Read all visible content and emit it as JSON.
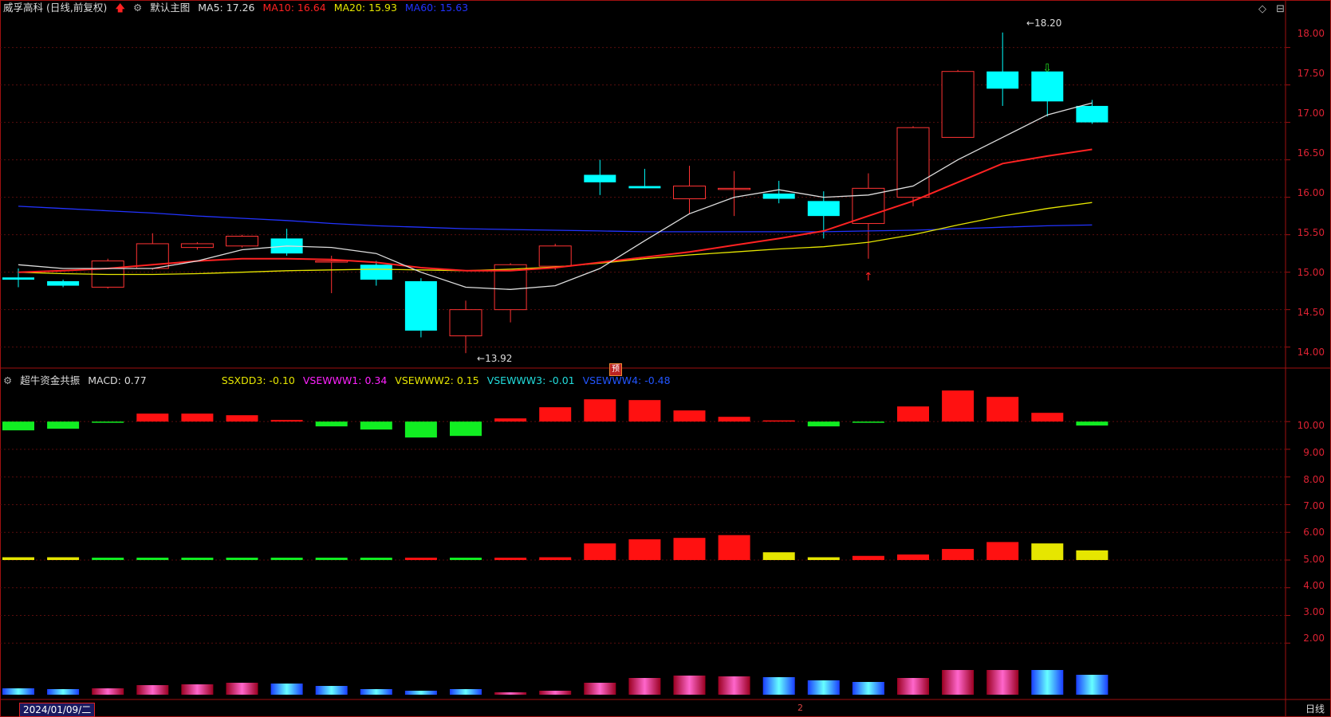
{
  "header": {
    "stock_name": "威孚高科 (日线,前复权)",
    "main_chart_label": "默认主图",
    "ma": [
      {
        "label": "MA5: 17.26",
        "color": "#dddddd"
      },
      {
        "label": "MA10: 16.64",
        "color": "#ff2222"
      },
      {
        "label": "MA20: 15.93",
        "color": "#e6e600"
      },
      {
        "label": "MA60: 15.63",
        "color": "#2233ff"
      }
    ]
  },
  "indicator_header": {
    "name": "超牛资金共振",
    "macd": "MACD: 0.77",
    "items": [
      {
        "label": "SSXDD3: -0.10",
        "color": "#e6e600"
      },
      {
        "label": "VSEWWW1: 0.34",
        "color": "#ff22ff"
      },
      {
        "label": "VSEWWW2: 0.15",
        "color": "#e6e600"
      },
      {
        "label": "VSEWWW3: -0.01",
        "color": "#22dddd"
      },
      {
        "label": "VSEWWW4: -0.48",
        "color": "#2255ff"
      }
    ]
  },
  "price_axis": [
    "18.00",
    "17.50",
    "17.00",
    "16.50",
    "16.00",
    "15.50",
    "15.00",
    "14.50",
    "14.00"
  ],
  "indicator_axis": [
    "10.00",
    "9.00",
    "8.00",
    "7.00",
    "6.00",
    "5.00",
    "4.00",
    "3.00",
    "2.00"
  ],
  "annotations": {
    "high": "18.20",
    "low": "13.92",
    "yu": "预"
  },
  "footer": {
    "date": "2024/01/09/二",
    "period": "日线",
    "marker": "2"
  },
  "chart_data": {
    "type": "candlestick",
    "candles": [
      {
        "o": 14.93,
        "c": 14.9,
        "h": 15.05,
        "l": 14.8
      },
      {
        "o": 14.88,
        "c": 14.82,
        "h": 14.9,
        "l": 14.8
      },
      {
        "o": 14.8,
        "c": 15.15,
        "h": 15.18,
        "l": 14.78
      },
      {
        "o": 15.05,
        "c": 15.38,
        "h": 15.52,
        "l": 15.03
      },
      {
        "o": 15.33,
        "c": 15.38,
        "h": 15.4,
        "l": 15.3
      },
      {
        "o": 15.35,
        "c": 15.48,
        "h": 15.5,
        "l": 15.33
      },
      {
        "o": 15.45,
        "c": 15.25,
        "h": 15.58,
        "l": 15.22
      },
      {
        "o": 15.15,
        "c": 15.15,
        "h": 15.22,
        "l": 14.72
      },
      {
        "o": 15.1,
        "c": 14.9,
        "h": 15.15,
        "l": 14.82
      },
      {
        "o": 14.88,
        "c": 14.22,
        "h": 14.92,
        "l": 14.13
      },
      {
        "o": 14.15,
        "c": 14.5,
        "h": 14.62,
        "l": 13.92
      },
      {
        "o": 14.5,
        "c": 15.1,
        "h": 15.12,
        "l": 14.33
      },
      {
        "o": 15.08,
        "c": 15.35,
        "h": 15.38,
        "l": 15.03
      },
      {
        "o": 16.3,
        "c": 16.2,
        "h": 16.5,
        "l": 16.03
      },
      {
        "o": 16.15,
        "c": 16.12,
        "h": 16.38,
        "l": 16.12
      },
      {
        "o": 15.98,
        "c": 16.15,
        "h": 16.42,
        "l": 15.78
      },
      {
        "o": 16.12,
        "c": 16.12,
        "h": 16.35,
        "l": 15.75
      },
      {
        "o": 16.05,
        "c": 15.98,
        "h": 16.22,
        "l": 15.92
      },
      {
        "o": 15.95,
        "c": 15.75,
        "h": 16.08,
        "l": 15.45
      },
      {
        "o": 15.65,
        "c": 16.12,
        "h": 16.32,
        "l": 15.18
      },
      {
        "o": 16.0,
        "c": 16.93,
        "h": 16.95,
        "l": 15.88
      },
      {
        "o": 16.8,
        "c": 17.68,
        "h": 17.7,
        "l": 16.8
      },
      {
        "o": 17.68,
        "c": 17.45,
        "h": 18.2,
        "l": 17.22
      },
      {
        "o": 17.68,
        "c": 17.28,
        "h": 17.68,
        "l": 17.08
      },
      {
        "o": 17.22,
        "c": 17.0,
        "h": 17.3,
        "l": 16.98
      }
    ],
    "ma5": [
      15.1,
      15.05,
      15.05,
      15.05,
      15.15,
      15.3,
      15.35,
      15.33,
      15.25,
      15.0,
      14.8,
      14.77,
      14.82,
      15.05,
      15.42,
      15.78,
      16.0,
      16.1,
      16.0,
      16.03,
      16.15,
      16.5,
      16.8,
      17.1,
      17.26
    ],
    "ma10": [
      15.0,
      15.02,
      15.05,
      15.1,
      15.15,
      15.18,
      15.18,
      15.17,
      15.13,
      15.06,
      15.02,
      15.02,
      15.06,
      15.13,
      15.2,
      15.27,
      15.36,
      15.45,
      15.55,
      15.75,
      15.95,
      16.2,
      16.45,
      16.55,
      16.64
    ],
    "ma20": [
      15.0,
      14.98,
      14.97,
      14.97,
      14.98,
      15.0,
      15.02,
      15.03,
      15.04,
      15.03,
      15.02,
      15.04,
      15.07,
      15.12,
      15.18,
      15.23,
      15.27,
      15.31,
      15.34,
      15.4,
      15.5,
      15.63,
      15.75,
      15.85,
      15.93
    ],
    "ma60": [
      15.88,
      15.85,
      15.82,
      15.79,
      15.75,
      15.72,
      15.69,
      15.65,
      15.62,
      15.6,
      15.58,
      15.57,
      15.56,
      15.55,
      15.54,
      15.54,
      15.54,
      15.54,
      15.54,
      15.55,
      15.56,
      15.58,
      15.6,
      15.62,
      15.63
    ],
    "macd_bars": [
      -0.55,
      -0.45,
      -0.05,
      0.5,
      0.5,
      0.4,
      0.1,
      -0.3,
      -0.5,
      -1.0,
      -0.9,
      0.2,
      0.9,
      1.4,
      1.35,
      0.7,
      0.3,
      0.05,
      -0.3,
      -0.05,
      0.95,
      1.95,
      1.55,
      0.55,
      -0.25
    ],
    "macd_colors": [
      "#11ee22",
      "#11ee22",
      "#11ee22",
      "#ff1111",
      "#ff1111",
      "#ff1111",
      "#ff1111",
      "#11ee22",
      "#11ee22",
      "#11ee22",
      "#11ee22",
      "#ff1111",
      "#ff1111",
      "#ff1111",
      "#ff1111",
      "#ff1111",
      "#ff1111",
      "#ff1111",
      "#11ee22",
      "#11ee22",
      "#ff1111",
      "#ff1111",
      "#ff1111",
      "#ff1111",
      "#11ee22"
    ],
    "sig_bars": [
      5.1,
      5.1,
      5.0,
      5.0,
      5.0,
      5.0,
      5.0,
      5.0,
      5.0,
      4.98,
      5.0,
      4.98,
      5.1,
      5.6,
      5.75,
      5.8,
      5.9,
      5.28,
      5.1,
      5.15,
      5.2,
      5.4,
      5.65,
      5.6,
      5.35
    ],
    "sig_colors": [
      "#e6e600",
      "#e6e600",
      "#11ee22",
      "#11ee22",
      "#11ee22",
      "#11ee22",
      "#11ee22",
      "#11ee22",
      "#11ee22",
      "#ff1111",
      "#11ee22",
      "#ff1111",
      "#ff1111",
      "#ff1111",
      "#ff1111",
      "#ff1111",
      "#ff1111",
      "#e6e600",
      "#e6e600",
      "#ff1111",
      "#ff1111",
      "#ff1111",
      "#ff1111",
      "#e6e600",
      "#e6e600"
    ],
    "vol_heights": [
      8,
      7,
      8,
      12,
      13,
      15,
      14,
      11,
      7,
      5,
      7,
      3,
      5,
      15,
      21,
      24,
      23,
      22,
      18,
      16,
      21,
      31,
      31,
      31,
      25
    ],
    "vol_types": [
      "cyan",
      "cyan",
      "red",
      "red",
      "red",
      "red",
      "cyan",
      "cyan",
      "cyan",
      "cyan",
      "cyan",
      "red",
      "red",
      "red",
      "red",
      "red",
      "red",
      "cyan",
      "cyan",
      "cyan",
      "red",
      "red",
      "red",
      "cyan",
      "cyan"
    ],
    "price_range": [
      13.72,
      18.4
    ],
    "indicator_range": [
      1.0,
      11.3
    ]
  }
}
